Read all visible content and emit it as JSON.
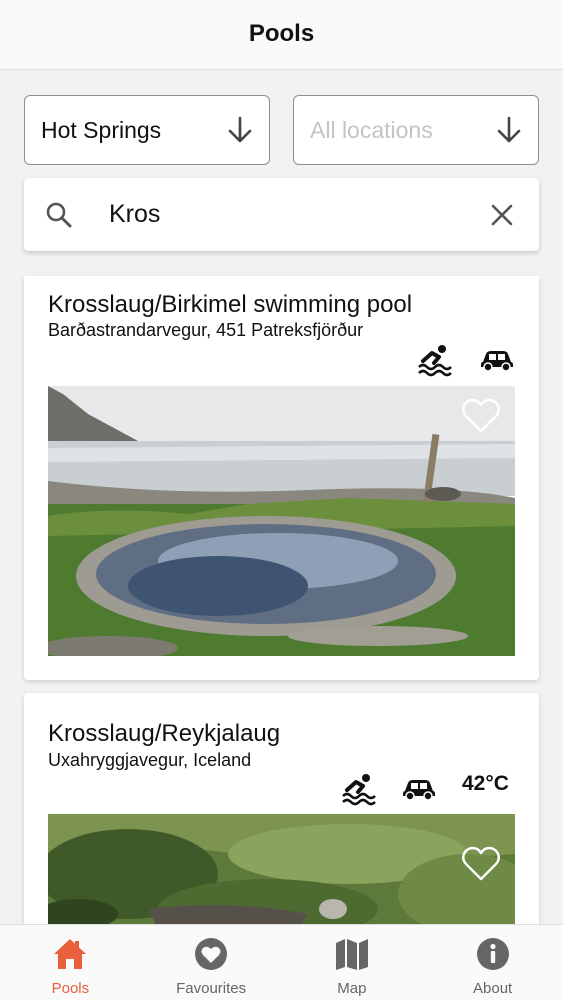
{
  "nav": {
    "title": "Pools"
  },
  "filters": {
    "type": {
      "value": "Hot Springs",
      "icon": "arrow-down-icon"
    },
    "location": {
      "placeholder": "All locations",
      "icon": "arrow-down-icon"
    }
  },
  "search": {
    "value": "Kros",
    "icon": "search-icon",
    "clear_icon": "close-icon"
  },
  "results": [
    {
      "name": "Krosslaug/Birkimel swimming pool",
      "address": "Barðastrandarvegur, 451 Patreksfjörður",
      "features": [
        "swimming-icon",
        "car-icon"
      ],
      "favourite": false
    },
    {
      "name": "Krosslaug/Reykjalaug",
      "address": "Uxahryggjavegur, Iceland",
      "features": [
        "swimming-icon",
        "car-icon"
      ],
      "temperature": "42°C",
      "favourite": false
    }
  ],
  "tabs": [
    {
      "label": "Pools",
      "icon": "home-icon",
      "active": true
    },
    {
      "label": "Favourites",
      "icon": "heart-icon",
      "active": false
    },
    {
      "label": "Map",
      "icon": "map-icon",
      "active": false
    },
    {
      "label": "About",
      "icon": "info-icon",
      "active": false
    }
  ],
  "colors": {
    "accent": "#e8603c",
    "inactive": "#666666",
    "background": "#f2f2f4"
  }
}
